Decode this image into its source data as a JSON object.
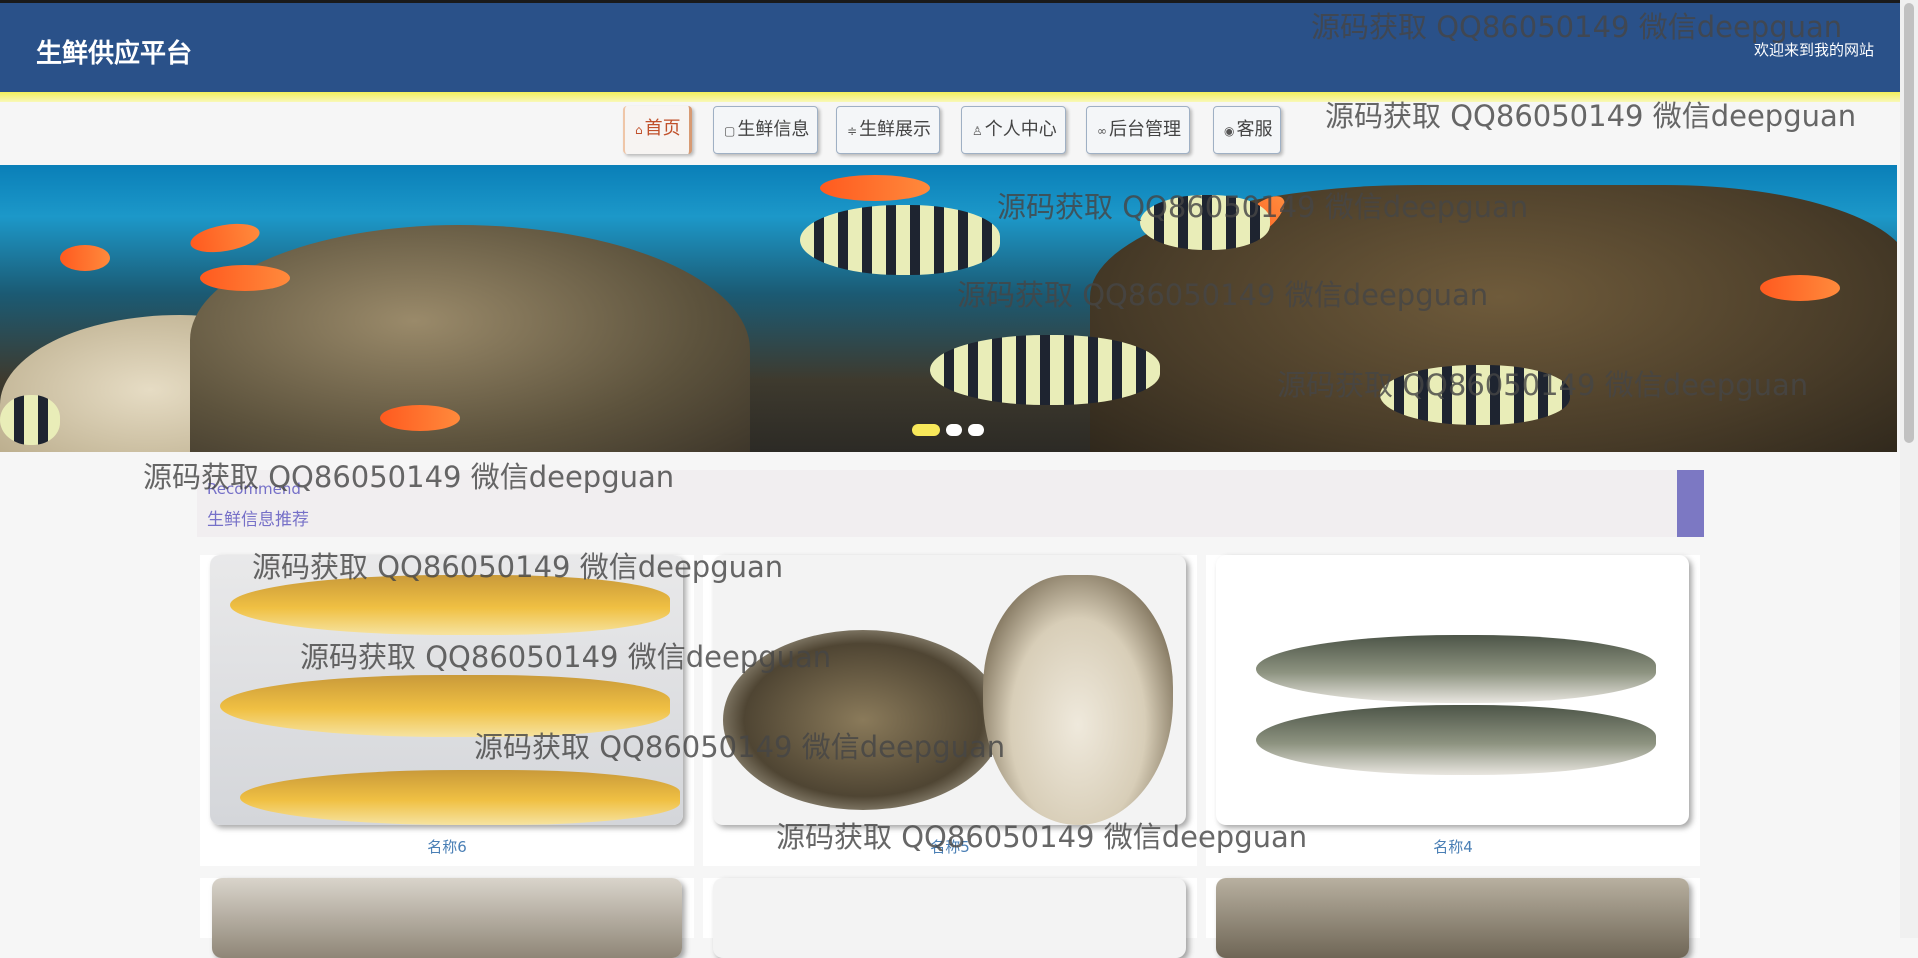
{
  "header": {
    "brand": "生鲜供应平台",
    "welcome": "欢迎来到我的网站"
  },
  "nav": [
    {
      "icon": "home-icon",
      "glyph": "⌂",
      "label": "首页",
      "active": true
    },
    {
      "icon": "document-icon",
      "glyph": "▢",
      "label": "生鲜信息",
      "active": false
    },
    {
      "icon": "sliders-icon",
      "glyph": "≑",
      "label": "生鲜展示",
      "active": false
    },
    {
      "icon": "user-icon",
      "glyph": "♙",
      "label": "个人中心",
      "active": false
    },
    {
      "icon": "link-icon",
      "glyph": "∞",
      "label": "后台管理",
      "active": false
    },
    {
      "icon": "service-icon",
      "glyph": "◉",
      "label": "客服",
      "active": false
    }
  ],
  "recommend": {
    "en": "Recommend",
    "cn": "生鲜信息推荐"
  },
  "cards": [
    {
      "name": "名称6",
      "image": "yellow-croaker-photo"
    },
    {
      "name": "名称5",
      "image": "oyster-photo"
    },
    {
      "name": "名称4",
      "image": "carp-photo"
    }
  ],
  "watermark": "源码获取 QQ86050149 微信deepguan",
  "colors": {
    "header_bg": "#2a5189",
    "accent_yellow": "#f3f05c",
    "recommend_text": "#7670c8",
    "card_name": "#4a7fb5"
  }
}
